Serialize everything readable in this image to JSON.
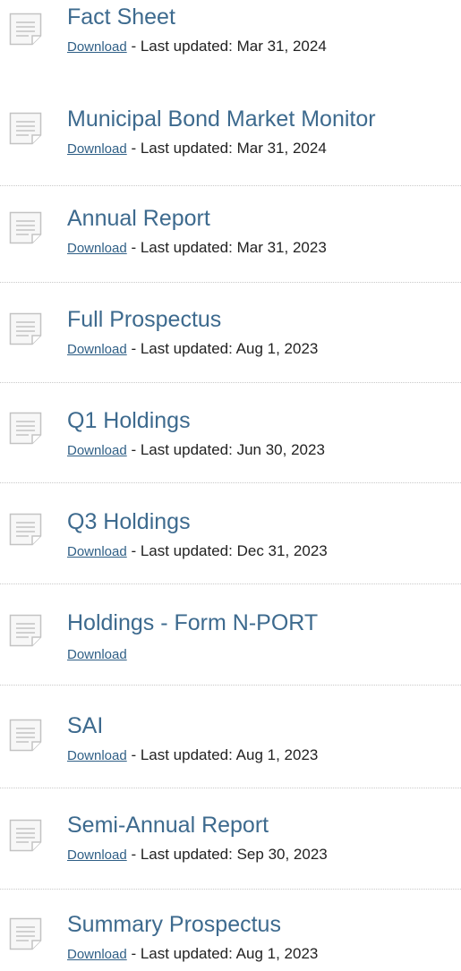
{
  "documents": [
    {
      "title": "Fact Sheet",
      "download_label": "Download",
      "separator": " - ",
      "updated_label": "Last updated:",
      "updated_date": "Mar 31, 2024"
    },
    {
      "title": "Municipal Bond Market Monitor",
      "download_label": "Download",
      "separator": " - ",
      "updated_label": "Last updated:",
      "updated_date": "Mar 31, 2024"
    },
    {
      "title": "Annual Report",
      "download_label": "Download",
      "separator": " - ",
      "updated_label": "Last updated:",
      "updated_date": "Mar 31, 2023"
    },
    {
      "title": "Full Prospectus",
      "download_label": "Download",
      "separator": " - ",
      "updated_label": "Last updated:",
      "updated_date": "Aug 1, 2023"
    },
    {
      "title": "Q1 Holdings",
      "download_label": "Download",
      "separator": " - ",
      "updated_label": "Last updated:",
      "updated_date": "Jun 30, 2023"
    },
    {
      "title": "Q3 Holdings",
      "download_label": "Download",
      "separator": " - ",
      "updated_label": "Last updated:",
      "updated_date": "Dec 31, 2023"
    },
    {
      "title": "Holdings - Form N-PORT",
      "download_label": "Download"
    },
    {
      "title": "SAI",
      "download_label": "Download",
      "separator": " - ",
      "updated_label": "Last updated:",
      "updated_date": "Aug 1, 2023"
    },
    {
      "title": "Semi-Annual Report",
      "download_label": "Download",
      "separator": " - ",
      "updated_label": "Last updated:",
      "updated_date": "Sep 30, 2023"
    },
    {
      "title": "Summary Prospectus",
      "download_label": "Download",
      "separator": " - ",
      "updated_label": "Last updated:",
      "updated_date": "Aug 1, 2023"
    }
  ],
  "icon": "document-icon"
}
